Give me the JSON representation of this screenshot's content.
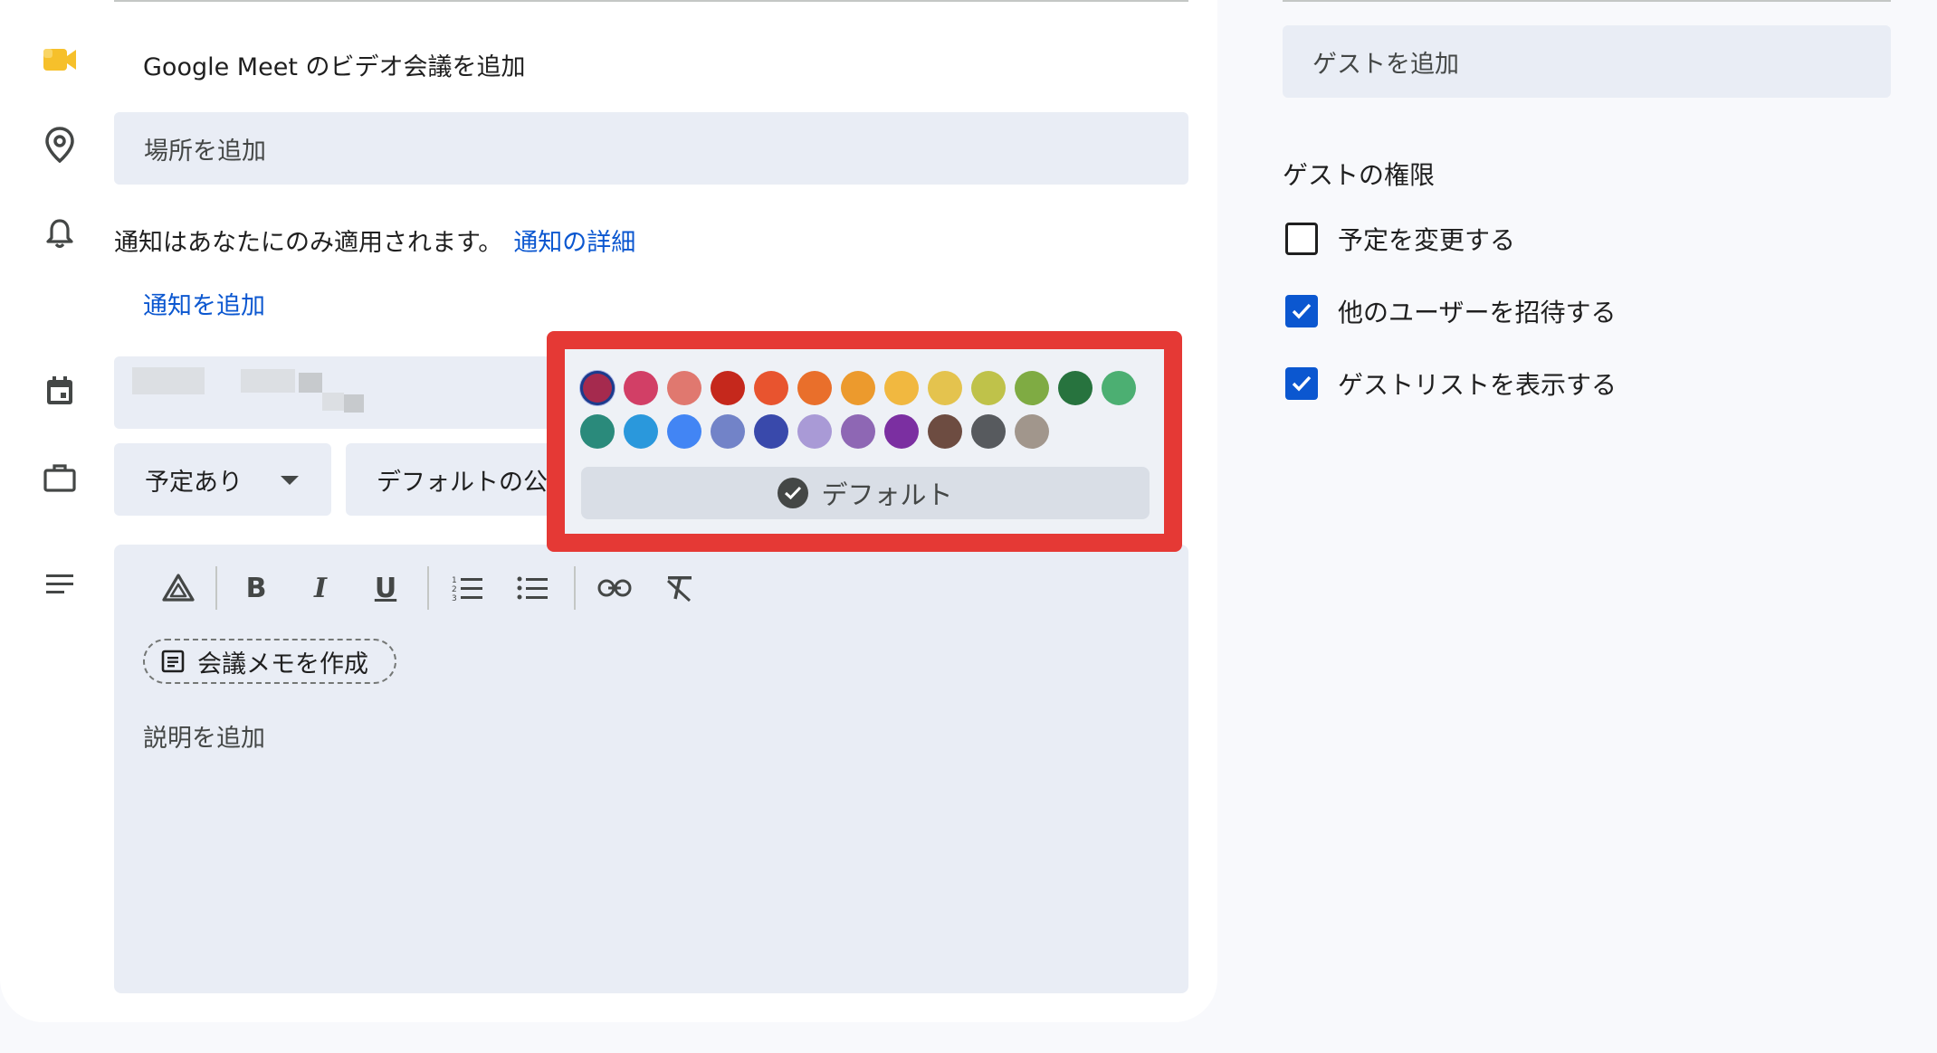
{
  "meet": {
    "label": "Google Meet のビデオ会議を追加",
    "icon": "google-meet-icon"
  },
  "location": {
    "placeholder": "場所を追加",
    "icon": "location-pin-icon"
  },
  "notification": {
    "info": "通知はあなたにのみ適用されます。",
    "details_link": "通知の詳細",
    "add_link": "通知を追加",
    "icon": "bell-icon"
  },
  "calendar": {
    "icon": "calendar-icon"
  },
  "availability": {
    "value": "予定あり",
    "icon": "briefcase-icon"
  },
  "visibility": {
    "value": "デフォルトの公開設定"
  },
  "editor": {
    "icon": "description-icon",
    "memo_button": "会議メモを作成",
    "placeholder": "説明を追加",
    "tools": [
      "drive-icon",
      "bold-icon",
      "italic-icon",
      "underline-icon",
      "numbered-list-icon",
      "bulleted-list-icon",
      "link-icon",
      "clear-format-icon"
    ]
  },
  "color_picker": {
    "row1": [
      "#a52a4e",
      "#d23f66",
      "#e0786f",
      "#c5281c",
      "#e8542f",
      "#e96f2b",
      "#ec9a2d",
      "#f1b840",
      "#e4c34e",
      "#bfc24a",
      "#7fab43",
      "#27733e",
      "#4caf72"
    ],
    "row2": [
      "#2a8a7b",
      "#2a98dc",
      "#4285f4",
      "#7283c8",
      "#3949ab",
      "#a99ad6",
      "#8e67b4",
      "#7b2fa1",
      "#6d4c41",
      "#575a5e",
      "#a1968c"
    ],
    "selected_index": 0,
    "default_label": "デフォルト",
    "highlight_color": "#e53935"
  },
  "guests": {
    "placeholder": "ゲストを追加"
  },
  "permissions": {
    "title": "ゲストの権限",
    "items": [
      {
        "label": "予定を変更する",
        "checked": false
      },
      {
        "label": "他のユーザーを招待する",
        "checked": true
      },
      {
        "label": "ゲストリストを表示する",
        "checked": true
      }
    ]
  }
}
